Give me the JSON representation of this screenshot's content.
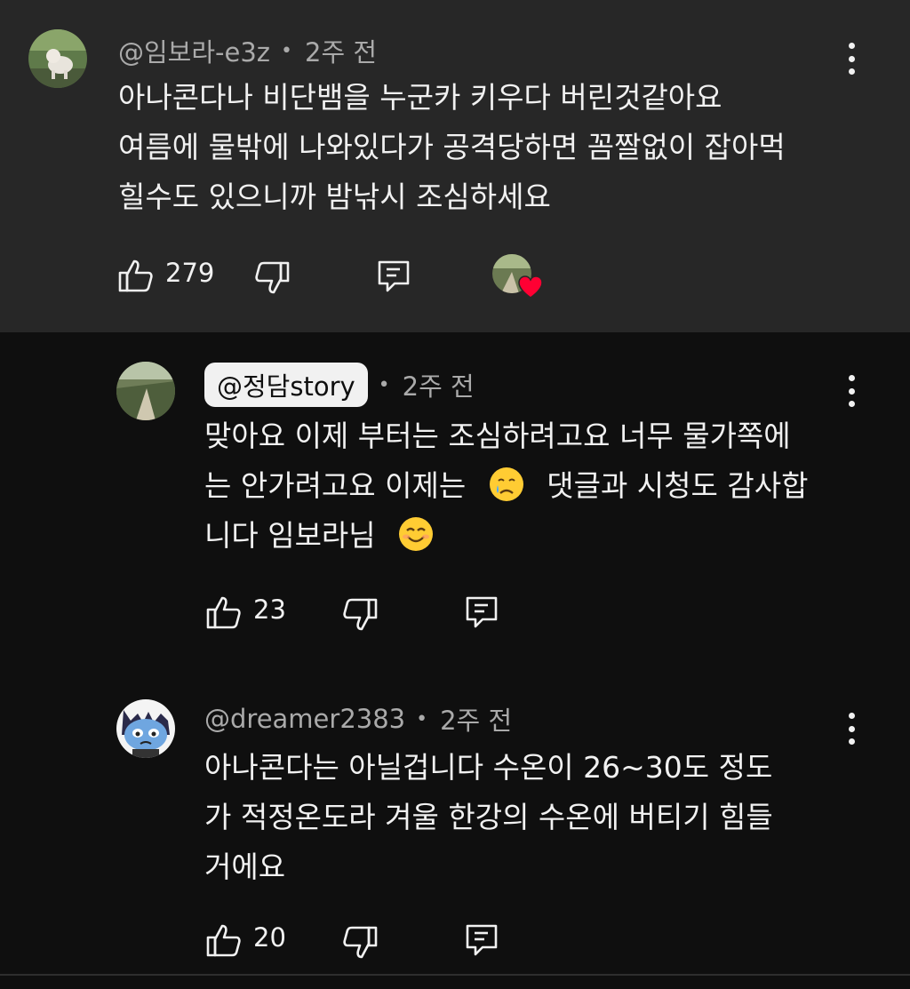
{
  "comments": [
    {
      "author": "@임보라-e3z",
      "time": "2주 전",
      "text_lines": [
        "아나콘다나 비단뱀을 누군카 키우다 버린것같아요",
        "여름에 물밖에 나와있다가 공격당하면 꼼짤없이 잡아먹",
        "힐수도 있으니까 밤낚시 조심하세요"
      ],
      "likes": "279",
      "creator_heart": true
    },
    {
      "author": "@정담story",
      "time": "2주 전",
      "text_lines": [
        "맞아요 이제 부터는 조심하려고요 너무 물가쪽에",
        "는 안가려고요 이제는",
        "댓글과 시청도 감사합",
        "니다 임보라님"
      ],
      "emoji_1": "crying-face-emoji",
      "emoji_2": "smiling-face-emoji",
      "likes": "23"
    },
    {
      "author": "@dreamer2383",
      "time": "2주 전",
      "text_lines": [
        "아나콘다는 아닐겁니다 수온이 26~30도 정도",
        "가 적정온도라 겨울 한강의 수온에 버티기 힘들",
        "거에요"
      ],
      "likes": "20"
    }
  ],
  "meta_separator": "•",
  "icons": {
    "like": "thumbs-up-icon",
    "dislike": "thumbs-down-icon",
    "reply": "reply-icon",
    "more": "more-vert-icon",
    "heart": "heart-icon"
  },
  "colors": {
    "parent_bg": "#272727",
    "page_bg": "#0f0f0f",
    "text": "#f1f1f1",
    "meta": "#aaaaaa",
    "heart": "#ff0033"
  }
}
